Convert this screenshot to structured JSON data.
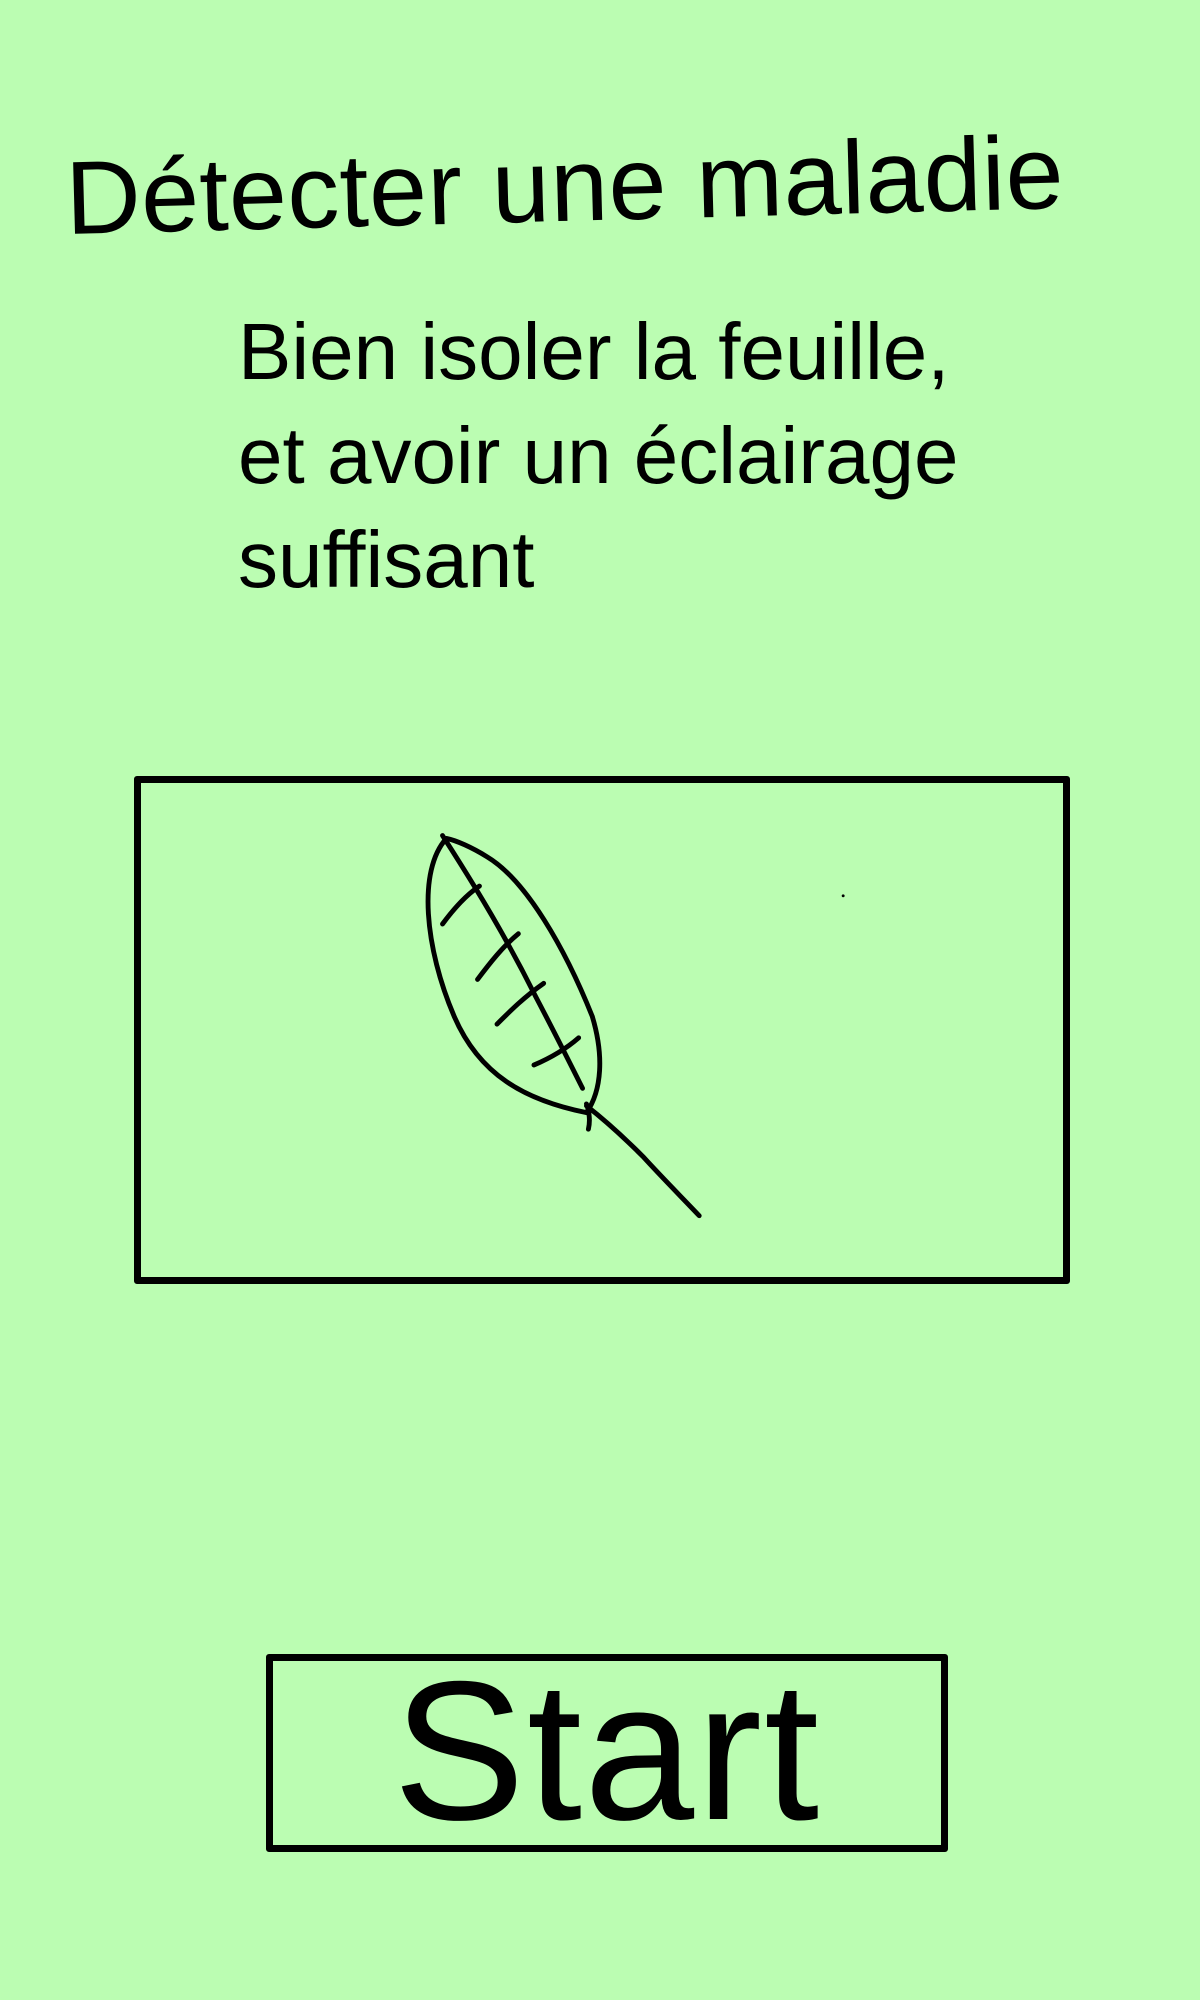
{
  "header": {
    "title": "Détecter une maladie"
  },
  "instructions": {
    "lines": [
      "Bien isoler la feuille,",
      "et avoir un éclairage",
      "suffisant"
    ]
  },
  "preview": {
    "illustration": "leaf-icon"
  },
  "actions": {
    "start_label": "Start"
  },
  "colors": {
    "background": "#bbfdb2",
    "ink": "#000000"
  }
}
